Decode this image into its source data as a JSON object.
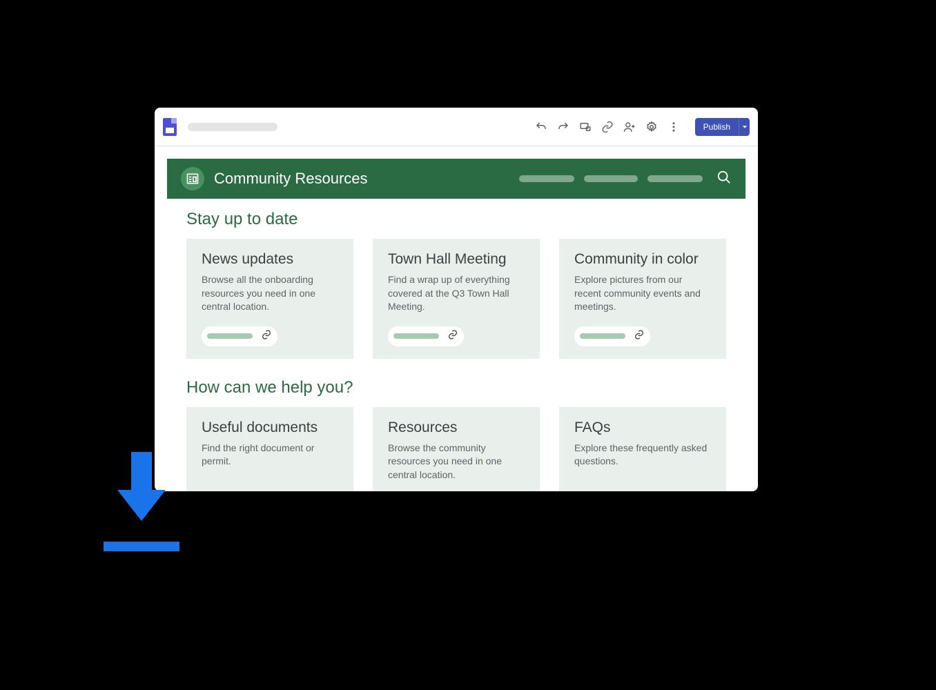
{
  "toolbar": {
    "publish_label": "Publish"
  },
  "page_header": {
    "title": "Community Resources"
  },
  "sections": [
    {
      "heading": "Stay up to date",
      "cards": [
        {
          "title": "News updates",
          "desc": "Browse all the onboarding resources you need in one central location."
        },
        {
          "title": "Town Hall Meeting",
          "desc": "Find a wrap up of everything covered at the Q3 Town Hall Meeting."
        },
        {
          "title": "Community in color",
          "desc": "Explore pictures from our recent community events and meetings."
        }
      ]
    },
    {
      "heading": "How can we help you?",
      "cards": [
        {
          "title": "Useful documents",
          "desc": "Find the right document or permit."
        },
        {
          "title": "Resources",
          "desc": "Browse the community resources you need in one central location."
        },
        {
          "title": "FAQs",
          "desc": "Explore these frequently asked questions."
        }
      ]
    }
  ]
}
